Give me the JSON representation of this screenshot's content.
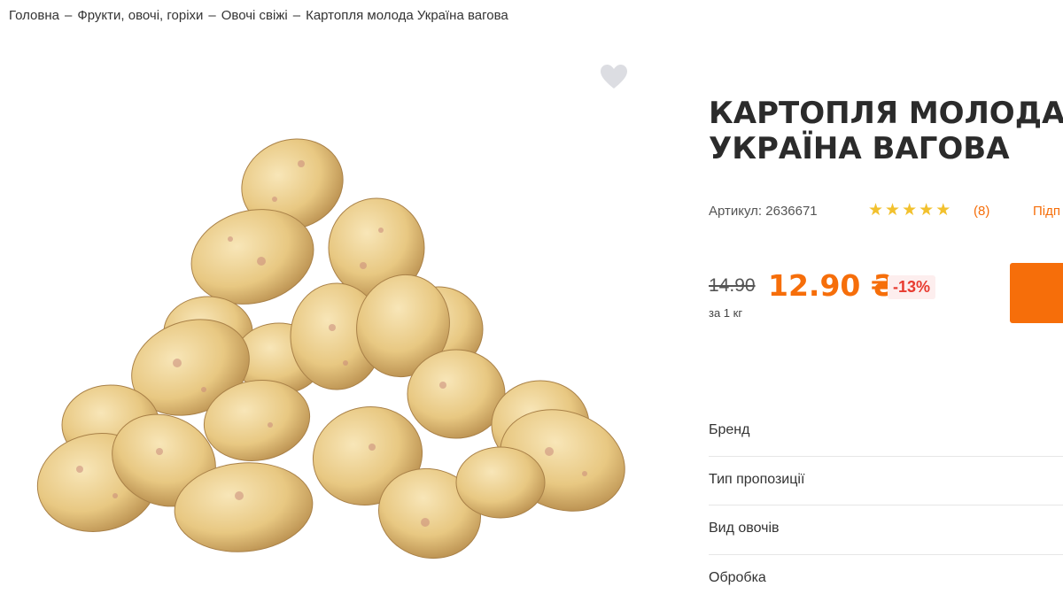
{
  "breadcrumb": {
    "items": [
      "Головна",
      "Фрукти, овочі, горіхи",
      "Овочі свіжі",
      "Картопля молода Україна вагова"
    ],
    "separator": "–"
  },
  "product": {
    "title_line1": "КАРТОПЛЯ МОЛОДА",
    "title_line2": "УКРАЇНА ВАГОВА",
    "sku": "Артикул: 2636671",
    "rating": 5,
    "rating_icons": [
      "star-icon",
      "star-icon",
      "star-icon",
      "star-icon",
      "star-icon"
    ],
    "star_glyph": "★",
    "reviews_count": "(8)",
    "subscribe_label": "Підп",
    "old_price": "14.90",
    "price": "12.90 ₴",
    "discount": "-13%",
    "unit": "за 1 кг",
    "image_icon": "potato-pile-image",
    "favorite_icon": "heart-icon"
  },
  "attributes": [
    {
      "label": "Бренд"
    },
    {
      "label": "Тип пропозиції"
    },
    {
      "label": "Вид овочів"
    },
    {
      "label": "Обробка"
    }
  ],
  "colors": {
    "accent": "#f66e0a",
    "discount_text": "#e83b30",
    "discount_bg": "#fdeeee",
    "star": "#f2c12e",
    "heart": "#dcdde2"
  }
}
